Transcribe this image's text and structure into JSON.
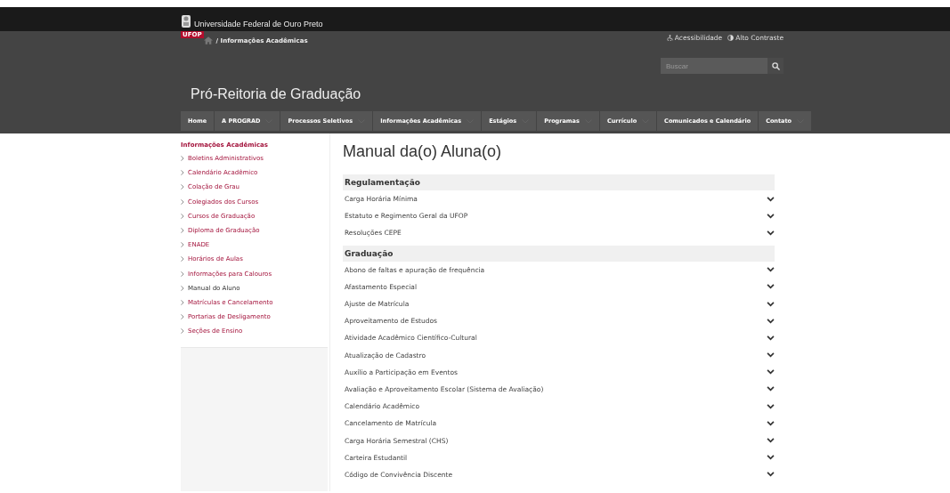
{
  "header": {
    "university": "Universidade Federal de Ouro Preto",
    "badge": "UFOP",
    "breadcrumb": [
      {
        "label": "/ Informações Acadêmicas"
      }
    ],
    "accessibility": "Acessibilidade",
    "contrast": "Alto Contraste",
    "search": {
      "placeholder": "Buscar"
    },
    "site_title": "Pró-Reitoria de Graduação"
  },
  "nav": [
    {
      "label": "Home",
      "dropdown": false
    },
    {
      "label": "A PROGRAD",
      "dropdown": true
    },
    {
      "label": "Processos Seletivos",
      "dropdown": true
    },
    {
      "label": "Informações Acadêmicas",
      "dropdown": true
    },
    {
      "label": "Estágios",
      "dropdown": true
    },
    {
      "label": "Programas",
      "dropdown": true
    },
    {
      "label": "Currículo",
      "dropdown": true
    },
    {
      "label": "Comunicados e Calendário",
      "dropdown": false
    },
    {
      "label": "Contato",
      "dropdown": true
    }
  ],
  "sidebar": {
    "title": "Informações Acadêmicas",
    "items": [
      {
        "label": "Boletins Administrativos",
        "selected": false
      },
      {
        "label": "Calendário Acadêmico",
        "selected": false
      },
      {
        "label": "Colação de Grau",
        "selected": false
      },
      {
        "label": "Colegiados dos Cursos",
        "selected": false
      },
      {
        "label": "Cursos de Graduação",
        "selected": false
      },
      {
        "label": "Diploma de Graduação",
        "selected": false
      },
      {
        "label": "ENADE",
        "selected": false
      },
      {
        "label": "Horários de Aulas",
        "selected": false
      },
      {
        "label": "Informações para Calouros",
        "selected": false
      },
      {
        "label": "Manual do Aluno",
        "selected": true
      },
      {
        "label": "Matrículas e Cancelamento",
        "selected": false
      },
      {
        "label": "Portarias de Desligamento",
        "selected": false
      },
      {
        "label": "Seções de Ensino",
        "selected": false
      }
    ]
  },
  "page_title": "Manual da(o) Aluna(o)",
  "sections": [
    {
      "title": "Regulamentação",
      "items": [
        {
          "label": "Carga Horária Mínima",
          "expanded": false
        },
        {
          "label": "Estatuto e Regimento Geral da UFOP",
          "expanded": false
        },
        {
          "label": "Resoluções CEPE",
          "expanded": false
        }
      ]
    },
    {
      "title": "Graduação",
      "items": [
        {
          "label": "Abono de faltas e apuração de frequência",
          "expanded": false
        },
        {
          "label": "Afastamento Especial",
          "expanded": false
        },
        {
          "label": "Ajuste de Matrícula",
          "expanded": false
        },
        {
          "label": "Aproveitamento de Estudos",
          "expanded": false
        },
        {
          "label": "Atividade Acadêmico Científico-Cultural",
          "expanded": false
        },
        {
          "label": "Atualização de Cadastro",
          "expanded": false
        },
        {
          "label": "Auxílio a Participação em Eventos",
          "expanded": false
        },
        {
          "label": "Avaliação e Aproveitamento Escolar (Sistema de Avaliação)",
          "expanded": false
        },
        {
          "label": "Calendário Acadêmico",
          "expanded": false
        },
        {
          "label": "Cancelamento de Matrícula",
          "expanded": false
        },
        {
          "label": "Carga Horária Semestral (CHS)",
          "expanded": false
        },
        {
          "label": "Carteira Estudantil",
          "expanded": false
        },
        {
          "label": "Código de Convivência Discente",
          "expanded": false
        }
      ]
    }
  ]
}
